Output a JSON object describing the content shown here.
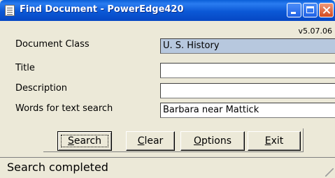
{
  "window": {
    "title": "Find Document - PowerEdge420",
    "version": "v5.07.06",
    "icons": [
      "document-icon",
      "minimize-icon",
      "maximize-icon",
      "close-icon"
    ]
  },
  "form": {
    "document_class": {
      "label": "Document Class",
      "value": "U. S. History"
    },
    "title": {
      "label": "Title",
      "value": ""
    },
    "description": {
      "label": "Description",
      "value": ""
    },
    "text_search": {
      "label": "Words for text search",
      "value": "Barbara near Mattick"
    }
  },
  "buttons": {
    "search": {
      "mnemonic": "S",
      "rest": "earch"
    },
    "clear": {
      "mnemonic": "C",
      "rest": "lear"
    },
    "options": {
      "mnemonic": "O",
      "rest": "ptions"
    },
    "exit": {
      "mnemonic": "E",
      "rest": "xit"
    }
  },
  "status": {
    "text": "Search completed"
  },
  "colors": {
    "titlebar": "#0b58d6",
    "window_bg": "#ece9d8",
    "readonly_field_bg": "#b7c8de",
    "close_button": "#d24a1f"
  }
}
